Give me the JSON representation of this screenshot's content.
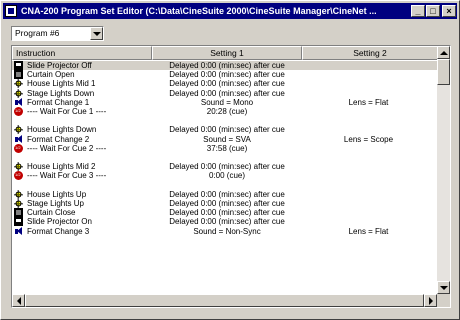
{
  "window": {
    "title": "CNA-200 Program Set Editor (C:\\Data\\CineSuite 2000\\CineSuite Manager\\CineNet ...",
    "minimize_label": "_",
    "maximize_label": "□",
    "close_label": "×"
  },
  "program_select": {
    "value": "Program #6"
  },
  "table": {
    "columns": [
      "Instruction",
      "Setting 1",
      "Setting 2"
    ],
    "rows": [
      {
        "icon": "projector",
        "instruction": "Slide Projector Off",
        "setting1": "Delayed 0:00 (min:sec) after cue",
        "setting2": "",
        "selected": true
      },
      {
        "icon": "curtain",
        "instruction": "Curtain Open",
        "setting1": "Delayed 0:00 (min:sec) after cue",
        "setting2": ""
      },
      {
        "icon": "light",
        "instruction": "House Lights Mid 1",
        "setting1": "Delayed 0:00 (min:sec) after cue",
        "setting2": ""
      },
      {
        "icon": "light",
        "instruction": "Stage Lights Down",
        "setting1": "Delayed 0:00 (min:sec) after cue",
        "setting2": ""
      },
      {
        "icon": "format",
        "instruction": "Format Change 1",
        "setting1": "Sound = Mono",
        "setting2": "Lens = Flat"
      },
      {
        "icon": "wait",
        "instruction": "---- Wait For Cue 1 ----",
        "setting1": "20:28 (cue)",
        "setting2": ""
      },
      {
        "icon": "",
        "instruction": "",
        "setting1": "",
        "setting2": ""
      },
      {
        "icon": "light",
        "instruction": "House Lights Down",
        "setting1": "Delayed 0:00 (min:sec) after cue",
        "setting2": ""
      },
      {
        "icon": "format",
        "instruction": "Format Change 2",
        "setting1": "Sound = SVA",
        "setting2": "Lens = Scope"
      },
      {
        "icon": "wait",
        "instruction": "---- Wait For Cue 2 ----",
        "setting1": "37:58 (cue)",
        "setting2": ""
      },
      {
        "icon": "",
        "instruction": "",
        "setting1": "",
        "setting2": ""
      },
      {
        "icon": "light",
        "instruction": "House Lights Mid 2",
        "setting1": "Delayed 0:00 (min:sec) after cue",
        "setting2": ""
      },
      {
        "icon": "wait",
        "instruction": "---- Wait For Cue 3 ----",
        "setting1": "0:00 (cue)",
        "setting2": ""
      },
      {
        "icon": "",
        "instruction": "",
        "setting1": "",
        "setting2": ""
      },
      {
        "icon": "light",
        "instruction": "House Lights Up",
        "setting1": "Delayed 0:00 (min:sec) after cue",
        "setting2": ""
      },
      {
        "icon": "light",
        "instruction": "Stage Lights Up",
        "setting1": "Delayed 0:00 (min:sec) after cue",
        "setting2": ""
      },
      {
        "icon": "curtain",
        "instruction": "Curtain Close",
        "setting1": "Delayed 0:00 (min:sec) after cue",
        "setting2": ""
      },
      {
        "icon": "projector",
        "instruction": "Slide Projector On",
        "setting1": "Delayed 0:00 (min:sec) after cue",
        "setting2": ""
      },
      {
        "icon": "format",
        "instruction": "Format Change 3",
        "setting1": "Sound = Non-Sync",
        "setting2": "Lens = Flat"
      }
    ]
  },
  "colors": {
    "titlebar": "#000080",
    "face": "#d4d0c8",
    "selection": "#d4d0c8"
  }
}
